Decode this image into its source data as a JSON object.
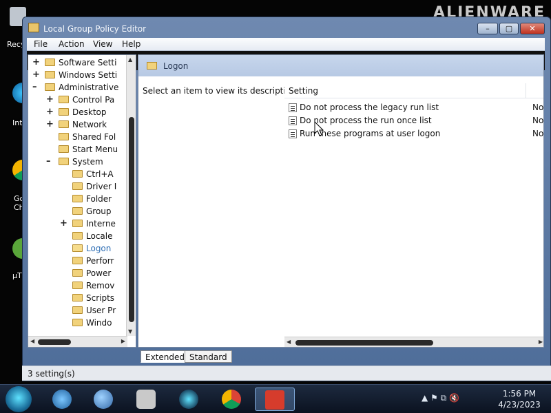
{
  "desktop": {
    "brand": "ALIENWARE",
    "icons": [
      {
        "label": "Recy"
      },
      {
        "label": "Int"
      },
      {
        "label": "Go Ch"
      },
      {
        "label": "µT"
      }
    ]
  },
  "window": {
    "title": "Local Group Policy Editor",
    "controls": {
      "minimize": "–",
      "maximize": "▢",
      "close": "✕"
    }
  },
  "menu": [
    "File",
    "Action",
    "View",
    "Help"
  ],
  "tree": {
    "items": [
      {
        "expander": "+",
        "label": "Software Setti",
        "level": 1
      },
      {
        "expander": "+",
        "label": "Windows Setti",
        "level": 1
      },
      {
        "expander": "–",
        "label": "Administrative",
        "level": 1
      },
      {
        "expander": "+",
        "label": "Control Pa",
        "level": 2
      },
      {
        "expander": "+",
        "label": "Desktop",
        "level": 2
      },
      {
        "expander": "+",
        "label": "Network",
        "level": 2
      },
      {
        "expander": "",
        "label": "Shared Fol",
        "level": 2
      },
      {
        "expander": "",
        "label": "Start Menu",
        "level": 2
      },
      {
        "expander": "–",
        "label": "System",
        "level": 2
      },
      {
        "expander": "",
        "label": "Ctrl+A",
        "level": 3
      },
      {
        "expander": "",
        "label": "Driver I",
        "level": 3
      },
      {
        "expander": "",
        "label": "Folder",
        "level": 3
      },
      {
        "expander": "",
        "label": "Group",
        "level": 3
      },
      {
        "expander": "+",
        "label": "Interne",
        "level": 3
      },
      {
        "expander": "",
        "label": "Locale",
        "level": 3
      },
      {
        "expander": "",
        "label": "Logon",
        "level": 3,
        "selected": true
      },
      {
        "expander": "",
        "label": "Perforr",
        "level": 3
      },
      {
        "expander": "",
        "label": "Power",
        "level": 3
      },
      {
        "expander": "",
        "label": "Remov",
        "level": 3
      },
      {
        "expander": "",
        "label": "Scripts",
        "level": 3
      },
      {
        "expander": "",
        "label": "User Pr",
        "level": 3
      },
      {
        "expander": "",
        "label": "Windo",
        "level": 3
      }
    ]
  },
  "content": {
    "header": "Logon",
    "description": "Select an item to view its description.",
    "column_setting": "Setting",
    "rows": [
      {
        "name": "Do not process the legacy run list",
        "state": "Not"
      },
      {
        "name": "Do not process the run once list",
        "state": "Not"
      },
      {
        "name": "Run these programs at user logon",
        "state": "Not"
      }
    ]
  },
  "tabs": [
    "Extended",
    "Standard"
  ],
  "status": "3 setting(s)",
  "taskbar": {
    "apps": [
      {
        "icon": "network-globe-icon"
      },
      {
        "icon": "planet-icon"
      },
      {
        "icon": "camera-icon"
      },
      {
        "icon": "alienware-icon"
      },
      {
        "icon": "chrome-icon"
      },
      {
        "icon": "toolbox-icon",
        "active": true
      }
    ],
    "tray": "▲  ⚑  ⧉  🔇",
    "time": "1:56 PM",
    "date": "4/23/2023"
  }
}
